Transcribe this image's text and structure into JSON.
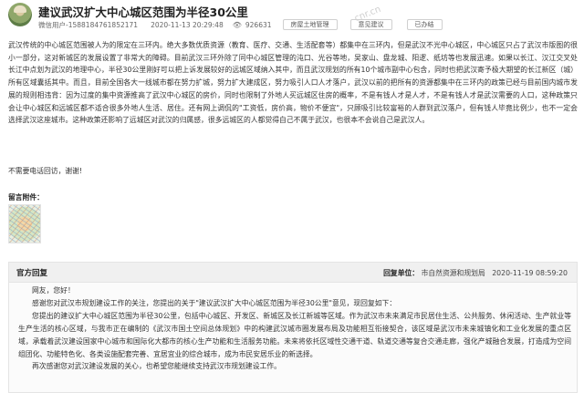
{
  "header": {
    "title": "建议武汉扩大中心城区范围为半径30公里",
    "user": "微信用户-1588184761852171",
    "date": "2020-11-13 20:29:48",
    "view_icon": "eye-icon",
    "view_count": "926631",
    "tags": [
      "房屋土地管理",
      "意见建议",
      "已办结"
    ],
    "watermark": "cnr.cn"
  },
  "message": {
    "body": "武汉传统的中心城区范围被人为的限定在三环内。绝大多数优质资源（教育、医疗、交通、生活配套等）都集中在三环内，但是武汉不光中心城区，中心城区只占了武汉市版图的很小一部分，这对新城区的发展设置了非常大的障碍。目前武汉三环外除了同中心城区管理的沌口、光谷等地，吴家山、盘龙城、阳逻、纸坊等也发展迅速。如果以长江、汉江交叉处长江中点划为武汉的地理中心，半径30公里刚好可以把上诉发展较好的远城区域纳入其中，而且武汉规划的所有10个城市副中心包含，同时也把武汉寄予极大期望的长江新区（城）所有区域囊括其中。而且，目前全国各大一线城市都在努力扩城，努力扩大建成区，努力吸引人口人才落户，武汉以前的把所有的资源都集中在三环内的政策已经与目前国内城市发展的规则相违背：因为过度的集中资源推高了武汉中心城区的房价，同时也限制了外地人买远城区住房的概率，不是有钱人才是人才，不是有钱人才是武汉需要的人口，这种政策只会让中心城区和远城区都不适合很多外地人生活、居住。还有网上调侃的\"工资低，房价高，物价不便宜\"，只顾吸引比较富裕的人群到武汉落户，但有钱人毕竟比例少，也不一定会选择武汉这座城市。这种政策还影响了远城区对武汉的归属感，很多远城区的人都觉得自己不属于武汉，也很本不会说自己是武汉人。",
    "thanks": "不需要电话回访，谢谢!",
    "attachment_label": "留言附件："
  },
  "reply": {
    "section_title": "官方回复",
    "unit_label": "回复单位：",
    "unit": "市自然资源和规划局",
    "date": "2020-11-19 08:59:20",
    "greeting": "网友，您好！",
    "p1": "感谢您对武汉市规划建设工作的关注，您提出的关于\"建议武汉扩大中心城区范围为半径30公里\"意见，现回复如下：",
    "p2": "您提出的建议扩大中心城区范围为半径30公里，包括中心城区、开发区、新城区及长江新城等区域。作为武汉市未来满足市民居住生活、公共服务、休闲活动、生产就业等生产生活的核心区域，与我市正在编制的《武汉市国土空间总体规划》中的构建武汉城市圈发展布局及功能相互衔接契合，该区域是武汉市未来城镇化和工业化发展的重点区域，承载着武汉建设国家中心城市和国际化大都市的核心生产功能和生活服务功能。未来将依托区域性交通干道、轨道交通等复合交通走廊，强化产城融合发展，打造成为空间组团化、功能特色化、各类设施配套完善、宜居宜业的综合城市，成为市民安居乐业的新选择。",
    "p3": "再次感谢您对武汉建设发展的关心，也希望您能继续支持武汉市规划建设工作。"
  }
}
